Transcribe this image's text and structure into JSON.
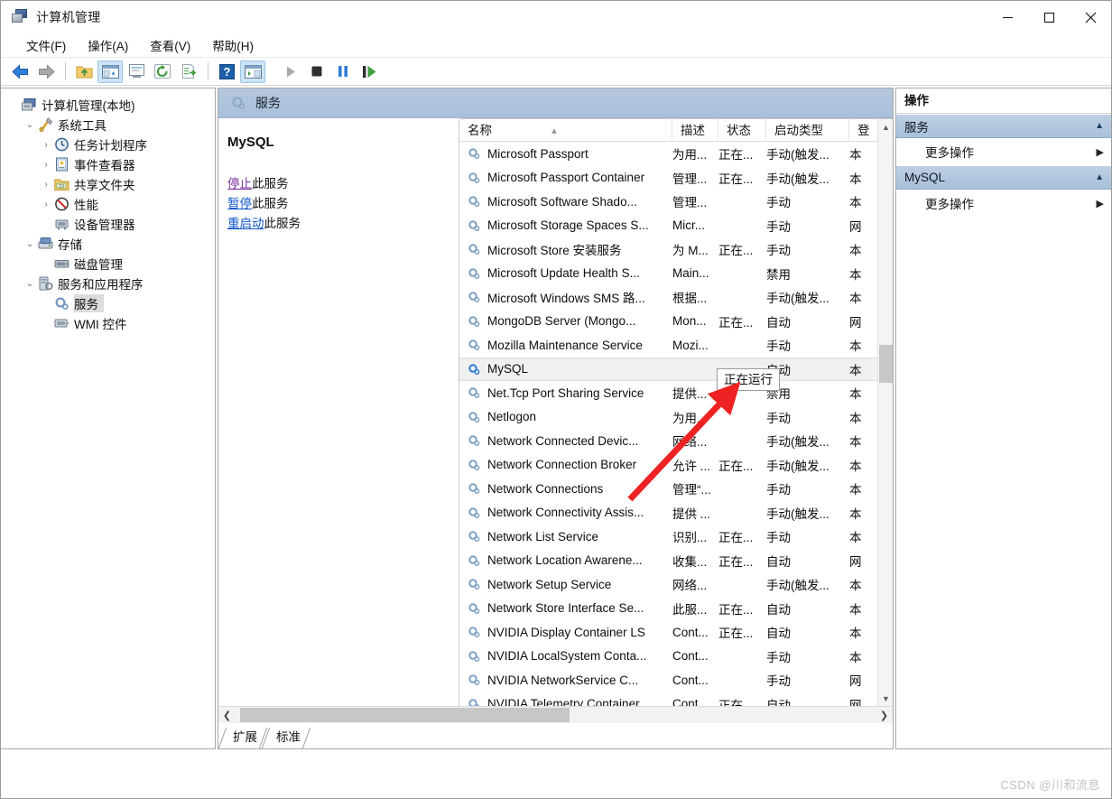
{
  "window": {
    "title": "计算机管理",
    "icon": "computer-management-icon",
    "controls": {
      "minimize": "–",
      "maximize": "□",
      "close": "✕"
    }
  },
  "menubar": [
    {
      "label": "文件(F)"
    },
    {
      "label": "操作(A)"
    },
    {
      "label": "查看(V)"
    },
    {
      "label": "帮助(H)"
    }
  ],
  "toolbar": [
    {
      "name": "back-arrow-icon",
      "state": "enabled"
    },
    {
      "name": "forward-arrow-icon",
      "state": "disabled"
    },
    {
      "name": "up-folder-icon",
      "state": "enabled"
    },
    {
      "name": "show-hide-tree-icon",
      "state": "active"
    },
    {
      "name": "properties-icon",
      "state": "enabled"
    },
    {
      "name": "refresh-icon",
      "state": "enabled"
    },
    {
      "name": "export-list-icon",
      "state": "enabled"
    },
    {
      "name": "help-icon",
      "state": "enabled"
    },
    {
      "name": "show-action-pane-icon",
      "state": "active"
    },
    {
      "name": "start-service-icon",
      "state": "disabled"
    },
    {
      "name": "stop-service-icon",
      "state": "enabled"
    },
    {
      "name": "pause-service-icon",
      "state": "enabled"
    },
    {
      "name": "restart-service-icon",
      "state": "enabled"
    }
  ],
  "tree": [
    {
      "label": "计算机管理(本地)",
      "depth": 0,
      "chevron": "",
      "icon": "computer-icon",
      "selected": false
    },
    {
      "label": "系统工具",
      "depth": 1,
      "chevron": "v",
      "icon": "tools-icon",
      "selected": false
    },
    {
      "label": "任务计划程序",
      "depth": 2,
      "chevron": ">",
      "icon": "clock-icon",
      "selected": false
    },
    {
      "label": "事件查看器",
      "depth": 2,
      "chevron": ">",
      "icon": "event-viewer-icon",
      "selected": false
    },
    {
      "label": "共享文件夹",
      "depth": 2,
      "chevron": ">",
      "icon": "shared-folder-icon",
      "selected": false
    },
    {
      "label": "性能",
      "depth": 2,
      "chevron": ">",
      "icon": "performance-icon",
      "selected": false
    },
    {
      "label": "设备管理器",
      "depth": 2,
      "chevron": "",
      "icon": "device-manager-icon",
      "selected": false
    },
    {
      "label": "存储",
      "depth": 1,
      "chevron": "v",
      "icon": "storage-icon",
      "selected": false
    },
    {
      "label": "磁盘管理",
      "depth": 2,
      "chevron": "",
      "icon": "disk-management-icon",
      "selected": false
    },
    {
      "label": "服务和应用程序",
      "depth": 1,
      "chevron": "v",
      "icon": "services-apps-icon",
      "selected": false
    },
    {
      "label": "服务",
      "depth": 2,
      "chevron": "",
      "icon": "service-gear-icon",
      "selected": true
    },
    {
      "label": "WMI 控件",
      "depth": 2,
      "chevron": "",
      "icon": "wmi-control-icon",
      "selected": false
    }
  ],
  "center": {
    "header_title": "服务",
    "header_icon": "service-gear-icon",
    "detail": {
      "service_name": "MySQL",
      "links": [
        {
          "action": "停止",
          "suffix": "此服务",
          "visited": true
        },
        {
          "action": "暂停",
          "suffix": "此服务",
          "visited": false
        },
        {
          "action": "重启动",
          "suffix": "此服务",
          "visited": false
        }
      ]
    },
    "columns": [
      {
        "key": "name",
        "label": "名称",
        "sorted": true
      },
      {
        "key": "desc",
        "label": "描述",
        "sorted": false
      },
      {
        "key": "stat",
        "label": "状态",
        "sorted": false
      },
      {
        "key": "type",
        "label": "启动类型",
        "sorted": false
      },
      {
        "key": "logon",
        "label": "登",
        "sorted": false
      }
    ],
    "rows": [
      {
        "name": "Microsoft Passport",
        "desc": "为用...",
        "stat": "正在...",
        "type": "手动(触发...",
        "logon": "本",
        "selected": false
      },
      {
        "name": "Microsoft Passport Container",
        "desc": "管理...",
        "stat": "正在...",
        "type": "手动(触发...",
        "logon": "本",
        "selected": false
      },
      {
        "name": "Microsoft Software Shado...",
        "desc": "管理...",
        "stat": "",
        "type": "手动",
        "logon": "本",
        "selected": false
      },
      {
        "name": "Microsoft Storage Spaces S...",
        "desc": "Micr...",
        "stat": "",
        "type": "手动",
        "logon": "网",
        "selected": false
      },
      {
        "name": "Microsoft Store 安装服务",
        "desc": "为 M...",
        "stat": "正在...",
        "type": "手动",
        "logon": "本",
        "selected": false
      },
      {
        "name": "Microsoft Update Health S...",
        "desc": "Main...",
        "stat": "",
        "type": "禁用",
        "logon": "本",
        "selected": false
      },
      {
        "name": "Microsoft Windows SMS 路...",
        "desc": "根据...",
        "stat": "",
        "type": "手动(触发...",
        "logon": "本",
        "selected": false
      },
      {
        "name": "MongoDB Server (Mongo...",
        "desc": "Mon...",
        "stat": "正在...",
        "type": "自动",
        "logon": "网",
        "selected": false
      },
      {
        "name": "Mozilla Maintenance Service",
        "desc": "Mozi...",
        "stat": "",
        "type": "手动",
        "logon": "本",
        "selected": false
      },
      {
        "name": "MySQL",
        "desc": "",
        "stat": "",
        "type": "自动",
        "logon": "本",
        "selected": true
      },
      {
        "name": "Net.Tcp Port Sharing Service",
        "desc": "提供...",
        "stat": "",
        "type": "禁用",
        "logon": "本",
        "selected": false
      },
      {
        "name": "Netlogon",
        "desc": "为用...",
        "stat": "",
        "type": "手动",
        "logon": "本",
        "selected": false
      },
      {
        "name": "Network Connected Devic...",
        "desc": "网络...",
        "stat": "",
        "type": "手动(触发...",
        "logon": "本",
        "selected": false
      },
      {
        "name": "Network Connection Broker",
        "desc": "允许 ...",
        "stat": "正在...",
        "type": "手动(触发...",
        "logon": "本",
        "selected": false
      },
      {
        "name": "Network Connections",
        "desc": "管理“...",
        "stat": "",
        "type": "手动",
        "logon": "本",
        "selected": false
      },
      {
        "name": "Network Connectivity Assis...",
        "desc": "提供 ...",
        "stat": "",
        "type": "手动(触发...",
        "logon": "本",
        "selected": false
      },
      {
        "name": "Network List Service",
        "desc": "识别...",
        "stat": "正在...",
        "type": "手动",
        "logon": "本",
        "selected": false
      },
      {
        "name": "Network Location Awarene...",
        "desc": "收集...",
        "stat": "正在...",
        "type": "自动",
        "logon": "网",
        "selected": false
      },
      {
        "name": "Network Setup Service",
        "desc": "网络...",
        "stat": "",
        "type": "手动(触发...",
        "logon": "本",
        "selected": false
      },
      {
        "name": "Network Store Interface Se...",
        "desc": "此服...",
        "stat": "正在...",
        "type": "自动",
        "logon": "本",
        "selected": false
      },
      {
        "name": "NVIDIA Display Container LS",
        "desc": "Cont...",
        "stat": "正在...",
        "type": "自动",
        "logon": "本",
        "selected": false
      },
      {
        "name": "NVIDIA LocalSystem Conta...",
        "desc": "Cont...",
        "stat": "",
        "type": "手动",
        "logon": "本",
        "selected": false
      },
      {
        "name": "NVIDIA NetworkService C...",
        "desc": "Cont...",
        "stat": "",
        "type": "手动",
        "logon": "网",
        "selected": false
      },
      {
        "name": "NVIDIA Telemetry Container",
        "desc": "Cont...",
        "stat": "正在...",
        "type": "自动",
        "logon": "网",
        "selected": false
      }
    ],
    "tabs": [
      {
        "label": "扩展"
      },
      {
        "label": "标准"
      }
    ]
  },
  "actions": {
    "title": "操作",
    "groups": [
      {
        "name": "服务",
        "items": [
          {
            "label": "更多操作"
          }
        ]
      },
      {
        "name": "MySQL",
        "items": [
          {
            "label": "更多操作"
          }
        ]
      }
    ]
  },
  "annotation": {
    "tooltip_text": "正在运行",
    "arrow_color": "#ee2222"
  },
  "watermark": "CSDN @川和流息"
}
